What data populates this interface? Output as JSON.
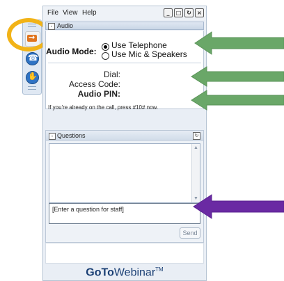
{
  "menu": {
    "file": "File",
    "view": "View",
    "help": "Help"
  },
  "window_buttons": [
    "_",
    "□",
    "↻",
    "×"
  ],
  "audio": {
    "header": "Audio",
    "mode_label": "Audio Mode:",
    "options": [
      "Use Telephone",
      "Use Mic & Speakers"
    ],
    "selected_index": 0,
    "dial_label": "Dial:",
    "access_code_label": "Access Code:",
    "audio_pin_label": "Audio PIN:",
    "note": "If you're already on the call, press #10# now."
  },
  "questions": {
    "header": "Questions",
    "input_placeholder": "[Enter a question for staff]",
    "send_label": "Send"
  },
  "footer": {
    "logo_bold": "GoTo",
    "logo_rest": "Webinar",
    "logo_tm": "TM"
  },
  "colors": {
    "highlight_ring": "#f2b317",
    "green_arrow": "#6aa768",
    "purple_arrow": "#6a2aa3",
    "hand_button": "#e0741d"
  },
  "icons": {
    "side_hand": "raise-hand-arrow-icon",
    "side_audio": "audio-icon",
    "side_other": "hand-icon"
  }
}
